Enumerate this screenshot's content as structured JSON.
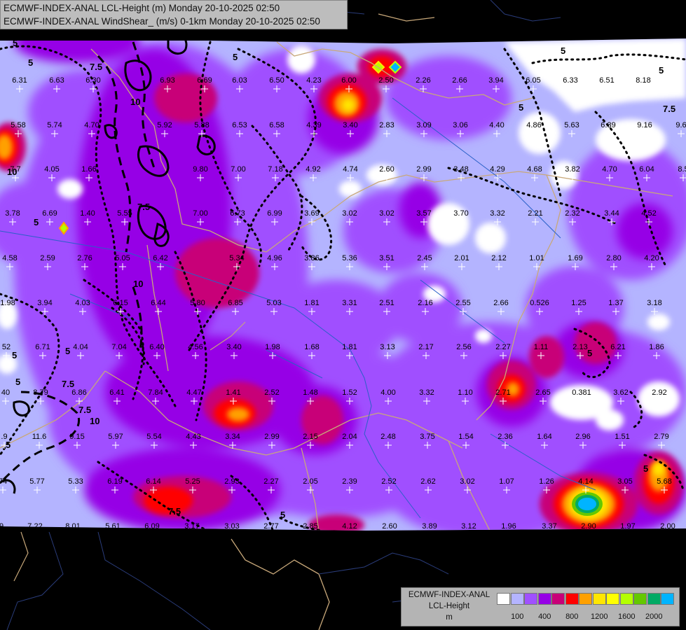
{
  "header": {
    "line1": "ECMWF-INDEX-ANAL LCL-Height (m) Monday 20-10-2025 02:50",
    "line2": "ECMWF-INDEX-ANAL WindShear_ (m/s) 0-1km Monday 20-10-2025 02:50"
  },
  "legend": {
    "title_line1": "ECMWF-INDEX-ANAL",
    "title_line2": "LCL-Height",
    "title_line3": "m",
    "colors": [
      "#ffffff",
      "#b4b4ff",
      "#a050ff",
      "#9600e6",
      "#c80078",
      "#ff0000",
      "#ffa000",
      "#ffe600",
      "#ffff00",
      "#b4ff00",
      "#64c800",
      "#00aa64",
      "#00b4ff"
    ],
    "ticks": [
      "100",
      "400",
      "800",
      "1200",
      "1600",
      "2000"
    ]
  },
  "contour_labels": [
    "5",
    "5",
    "7.5",
    "10",
    "10",
    "5",
    "5",
    "5",
    "5",
    "5",
    "7.5",
    "7.5",
    "5",
    "7.5",
    "5",
    "5",
    "10",
    "5",
    "7.5",
    "5",
    "7.5",
    "5",
    "10",
    "5"
  ],
  "station_values": [
    "6.31",
    "6.63",
    "6.30",
    "6.93",
    "6.69",
    "6.03",
    "6.50",
    "4.23",
    "6.00",
    "2.50",
    "2.26",
    "2.66",
    "3.94",
    "6.05",
    "6.33",
    "6.51",
    "8.18",
    "5.58",
    "5.74",
    "4.70",
    "5.92",
    "5.88",
    "6.53",
    "6.58",
    "4.39",
    "3.40",
    "2.83",
    "3.09",
    "3.06",
    "4.40",
    "4.86",
    "5.63",
    "6.39",
    "9.16",
    "9.6",
    "7.7",
    "4.05",
    "1.66",
    "9.80",
    "7.00",
    "7.18",
    "4.92",
    "4.74",
    "2.60",
    "2.99",
    "3.48",
    "4.29",
    "4.68",
    "3.82",
    "4.70",
    "6.04",
    "8.5",
    "3.78",
    "6.69",
    "1.40",
    "5.55",
    "7.00",
    "6.73",
    "6.99",
    "3.69",
    "3.02",
    "3.02",
    "3.57",
    "3.70",
    "3.32",
    "2.21",
    "2.32",
    "3.44",
    "4.52",
    "4.58",
    "2.59",
    "2.76",
    "5.05",
    "6.42",
    "5.34",
    "4.96",
    "3.86",
    "5.36",
    "3.51",
    "2.45",
    "2.01",
    "2.12",
    "1.01",
    "1.69",
    "2.80",
    "4.20",
    "1.98",
    "3.94",
    "4.03",
    "6.15",
    "6.44",
    "5.80",
    "6.85",
    "5.03",
    "1.81",
    "3.31",
    "2.51",
    "2.16",
    "2.55",
    "2.66",
    "0.526",
    "1.25",
    "1.37",
    "3.18",
    "52",
    "6.71",
    "4.04",
    "7.04",
    "6.40",
    "4.56",
    "3.40",
    "1.98",
    "1.68",
    "1.81",
    "3.13",
    "2.17",
    "2.56",
    "2.27",
    "1.11",
    "2.13",
    "6.21",
    "1.86",
    "40",
    "8.79",
    "6.86",
    "6.41",
    "7.84",
    "4.47",
    "1.41",
    "2.52",
    "1.48",
    "1.52",
    "4.00",
    "3.32",
    "1.10",
    "2.71",
    "2.65",
    "0.381",
    "3.62",
    "2.92",
    ".9",
    "11.6",
    "9.15",
    "5.97",
    "5.54",
    "4.43",
    "3.34",
    "2.99",
    "2.15",
    "2.04",
    "2.48",
    "3.75",
    "1.54",
    "2.36",
    "1.64",
    "2.96",
    "1.51",
    "2.79",
    "74",
    "5.77",
    "5.33",
    "6.19",
    "6.14",
    "5.25",
    "2.93",
    "2.27",
    "2.05",
    "2.39",
    "2.52",
    "2.62",
    "3.02",
    "1.07",
    "1.26",
    "4.14",
    "3.05",
    "5.68",
    "9",
    "7.22",
    "8.01",
    "5.61",
    "6.09",
    "3.17",
    "3.03",
    "2.77",
    "2.85",
    "4.12",
    "2.60",
    "3.89",
    "3.12",
    "1.96",
    "3.37",
    "2.90",
    "1.97",
    "2.00"
  ]
}
